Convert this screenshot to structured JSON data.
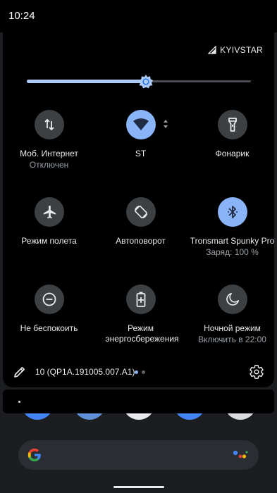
{
  "status_bar": {
    "time": "10:24"
  },
  "carrier": {
    "name": "KYIVSTAR"
  },
  "brightness": {
    "level": 0.53
  },
  "tiles": [
    {
      "label": "Моб. Интернет",
      "sub": "Отключен",
      "icon": "mobile-data-icon",
      "active": false
    },
    {
      "label": "ST",
      "sub": "",
      "icon": "wifi-icon",
      "active": true
    },
    {
      "label": "Фонарик",
      "sub": "",
      "icon": "flashlight-icon",
      "active": false
    },
    {
      "label": "Режим полета",
      "sub": "",
      "icon": "airplane-icon",
      "active": false
    },
    {
      "label": "Автоповорот",
      "sub": "",
      "icon": "auto-rotate-icon",
      "active": false
    },
    {
      "label": "Tronsmart Spunky Pro",
      "sub": "Заряд: 100 %",
      "icon": "bluetooth-icon",
      "active": true
    },
    {
      "label": "Не беспокоить",
      "sub": "",
      "icon": "do-not-disturb-icon",
      "active": false
    },
    {
      "label": "Режим энергосбережения",
      "sub": "",
      "icon": "battery-saver-icon",
      "active": false
    },
    {
      "label": "Ночной режим",
      "sub": "Включить в 22:00",
      "icon": "night-mode-icon",
      "active": false
    }
  ],
  "footer": {
    "build": "10 (QP1A.191005.007.A1)",
    "page_count": 2,
    "active_page": 1
  },
  "colors": {
    "active_tile": "#8ab4f8",
    "inactive_tile": "#3c4043",
    "panel_bg": "#000000",
    "slider_fill": "#aecbfa"
  },
  "dock": [
    {
      "icon": "phone-app-icon",
      "color": "#4285f4"
    },
    {
      "icon": "messages-app-icon",
      "color": "#8ab4f8"
    },
    {
      "icon": "gmail-app-icon",
      "color": "#f1f3f4"
    },
    {
      "icon": "chrome-app-icon",
      "color": "#4285f4"
    },
    {
      "icon": "camera-app-icon",
      "color": "#e8eaed"
    }
  ]
}
